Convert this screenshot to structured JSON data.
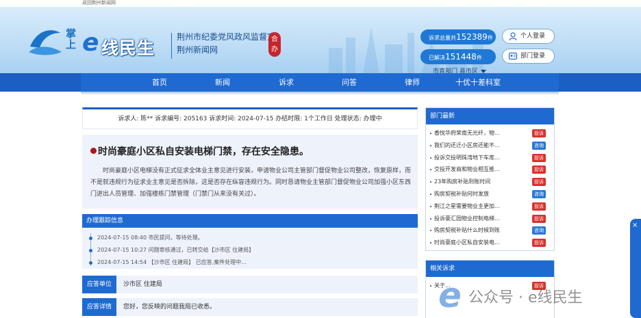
{
  "topstrip": {
    "text": "返回荆州新闻网"
  },
  "header": {
    "cloud_text": "掌上",
    "logo_e": "e",
    "logo_text": "线民生",
    "org_line1": "荆州市纪委党风政风监督室",
    "org_line2": "荆州新闻网",
    "co_badge": "合办",
    "stat1_prefix": "诉求总量共",
    "stat1_value": "152389",
    "stat1_suffix": "件",
    "stat2_prefix": "已解决",
    "stat2_value": "151448",
    "stat2_suffix": "件",
    "login_personal": "个人登录",
    "login_dept": "部门登录",
    "region_text": "市直部门  县市区"
  },
  "nav": {
    "items": [
      "首页",
      "新闻",
      "诉求",
      "问答",
      "律师",
      "十优十差科室"
    ]
  },
  "case_info": {
    "text": "诉求人: 陈**  诉求编号: 205163  诉求时间: 2024-07-15  办结时限: 1个工作日  处理状态: 办理中"
  },
  "case": {
    "title": "时尚豪庭小区私自安装电梯门禁，存在安全隐患。",
    "body": "时尚豪庭小区电梯没有正式征求全体业主意见进行安装，申请物业公司主管部门督促物业公司整改，恢复原样，而不是就违规行为征求业主意见是否拆除，这是否存在纵容违规行为。同时恳请物业主管部门督促物业公司加强小区东西门进出人员管理、加强楼栋门禁管理（门禁门从来没有关过）。"
  },
  "tracking": {
    "title": "办理跟踪信息",
    "items": [
      "2024-07-15 08:40 市民提问，等待处理。",
      "2024-07-15 10:27 问题审核通过，已转交给【沙市区 住建局】",
      "2024-07-15 14:54 【沙市区 住建局】 已应答,案件处理中..."
    ]
  },
  "response": {
    "unit_label": "应答单位",
    "unit_value": "沙市区 住建局",
    "detail_label": "应答详情",
    "detail_value": "您好，您反映的问题我局已收悉。"
  },
  "sidebar": {
    "latest_title": "部门最新",
    "latest_items": [
      {
        "text": "香悦华府荣南无光纤，物...",
        "tag": "投诉",
        "tag_color": "red"
      },
      {
        "text": "我们的还迁小区房还能不...",
        "tag": "咨询",
        "tag_color": "blue"
      },
      {
        "text": "投诉交投明珠湾地下车库...",
        "tag": "投诉",
        "tag_color": "red"
      },
      {
        "text": "交投开发商和物业相互推...",
        "tag": "投诉",
        "tag_color": "red"
      },
      {
        "text": "23年购房补贴到账时间",
        "tag": "投诉",
        "tag_color": "red"
      },
      {
        "text": "购房契税补贴何时发放",
        "tag": "咨询",
        "tag_color": "blue"
      },
      {
        "text": "荆江之星需要物业主更加...",
        "tag": "投诉",
        "tag_color": "red"
      },
      {
        "text": "投诉豪汇园物业控制电梯...",
        "tag": "投诉",
        "tag_color": "red"
      },
      {
        "text": "购房契税补贴什么时候到账",
        "tag": "咨询",
        "tag_color": "blue"
      },
      {
        "text": "时尚豪庭小区私自安装电...",
        "tag": "投诉",
        "tag_color": "red"
      }
    ],
    "related_title": "相关诉求",
    "related_items": [
      {
        "text": "关于...",
        "tag": "投诉",
        "tag_color": "red"
      }
    ]
  },
  "floatbar": {
    "close": "×"
  },
  "watermark": {
    "e": "e",
    "text": "公众号 · e线民生"
  }
}
